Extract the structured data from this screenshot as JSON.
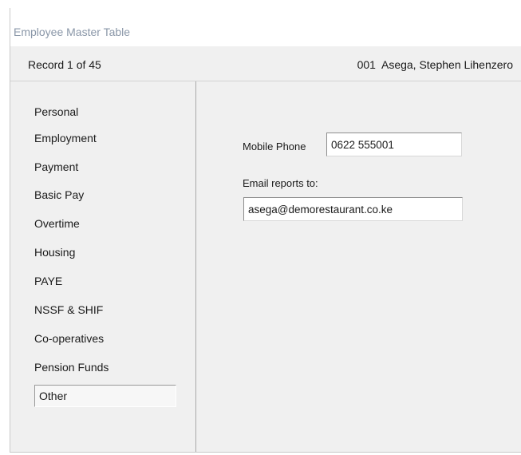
{
  "window": {
    "title": "Employee Master Table"
  },
  "record": {
    "position": "Record 1 of 45",
    "employee": "001  Asega, Stephen Lihenzero"
  },
  "nav": {
    "items": [
      {
        "label": "Personal"
      },
      {
        "label": "Employment"
      },
      {
        "label": "Payment"
      },
      {
        "label": "Basic Pay"
      },
      {
        "label": "Overtime"
      },
      {
        "label": "Housing"
      },
      {
        "label": "PAYE"
      },
      {
        "label": "NSSF & SHIF"
      },
      {
        "label": "Co-operatives"
      },
      {
        "label": "Pension Funds"
      },
      {
        "label": "Other"
      }
    ],
    "selected": "Other"
  },
  "form": {
    "mobile_label": "Mobile Phone",
    "mobile_value": "0622 555001",
    "email_label": "Email reports to:",
    "email_value": "asega@demorestaurant.co.ke"
  }
}
